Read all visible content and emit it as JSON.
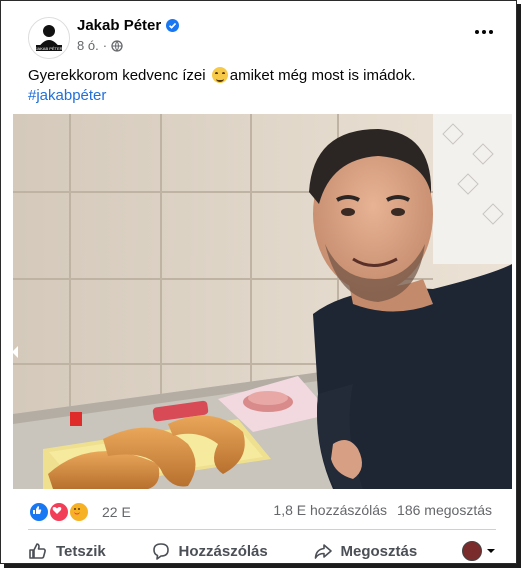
{
  "post": {
    "author": "Jakab Péter",
    "time": "8 ó.",
    "text_before": "Gyerekkorom kedvenc ízei",
    "text_after": "amiket még most is imádok.",
    "hashtag": "#jakabpéter",
    "emoji_icon": "smiling-face-emoji",
    "photo_icon": "selfie-with-bread-photo"
  },
  "stats": {
    "reactions_count": "22 E",
    "comments": "1,8 E hozzászólás",
    "shares": "186 megosztás"
  },
  "actions": {
    "like": "Tetszik",
    "comment": "Hozzászólás",
    "share": "Megosztás"
  },
  "colors": {
    "hashtag": "#216fdb",
    "like_reaction": "#1877f2",
    "love_reaction": "#f33e58",
    "care_reaction": "#f7b125",
    "verified": "#1877f2"
  }
}
